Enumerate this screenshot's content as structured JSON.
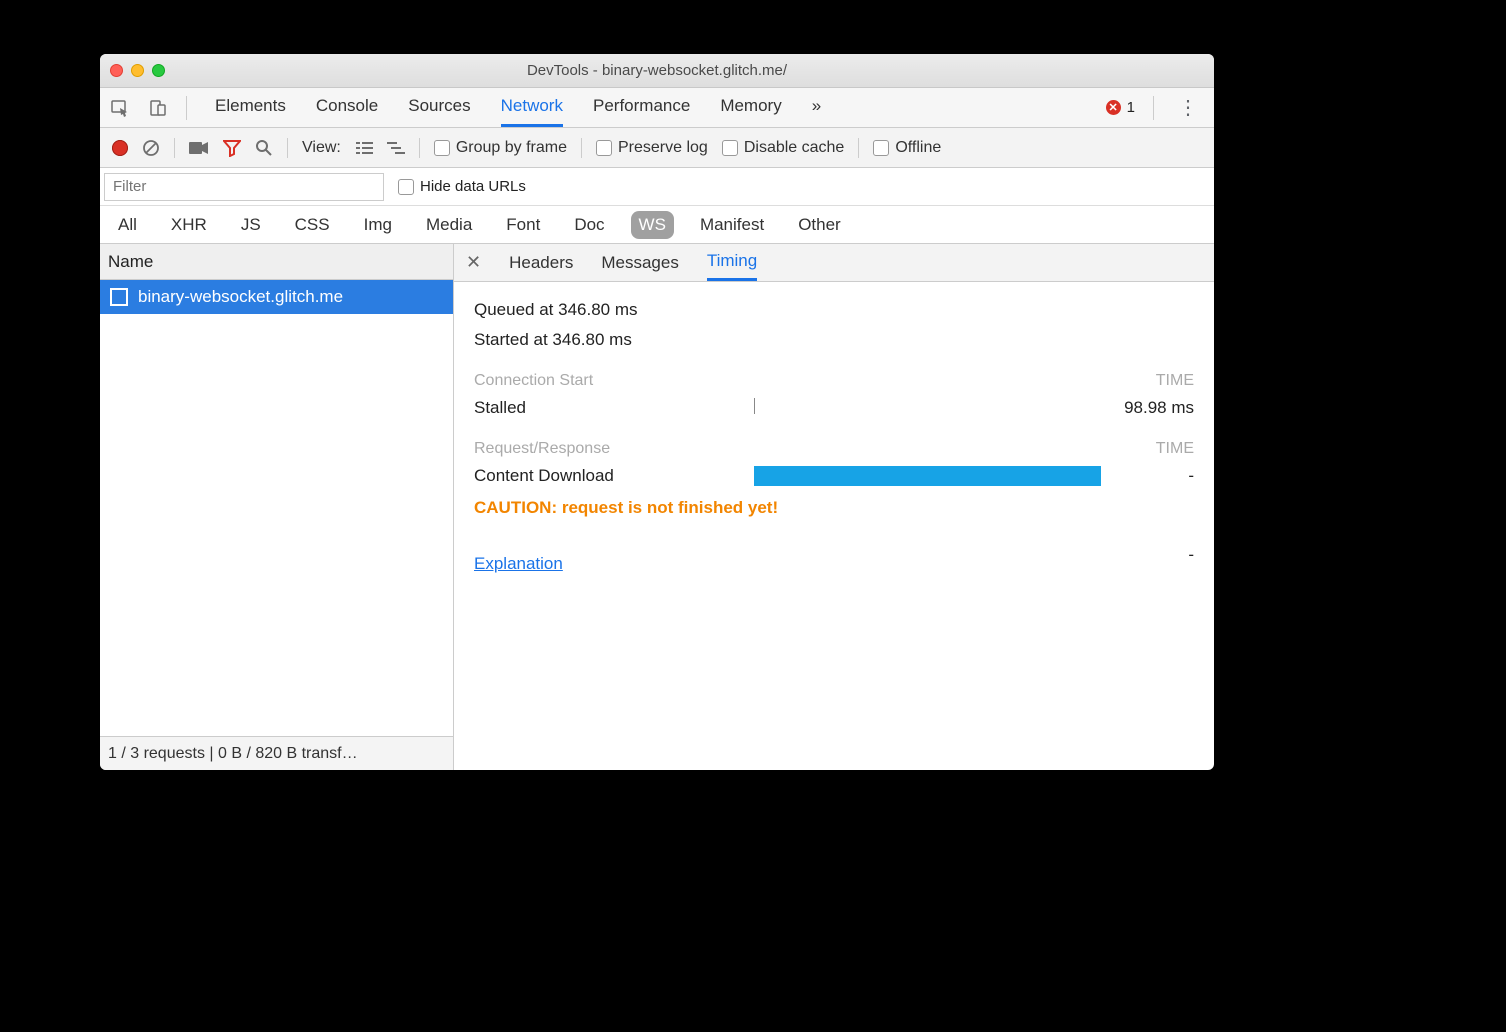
{
  "window": {
    "title": "DevTools - binary-websocket.glitch.me/"
  },
  "mainTabs": {
    "items": [
      "Elements",
      "Console",
      "Sources",
      "Network",
      "Performance",
      "Memory"
    ],
    "active": "Network",
    "overflow": "»",
    "errorCount": "1"
  },
  "toolbar": {
    "viewLabel": "View:",
    "groupByFrame": "Group by frame",
    "preserveLog": "Preserve log",
    "disableCache": "Disable cache",
    "offline": "Offline"
  },
  "filter": {
    "placeholder": "Filter",
    "hideDataUrls": "Hide data URLs"
  },
  "typeFilters": {
    "items": [
      "All",
      "XHR",
      "JS",
      "CSS",
      "Img",
      "Media",
      "Font",
      "Doc",
      "WS",
      "Manifest",
      "Other"
    ],
    "active": "WS"
  },
  "nameColumn": {
    "header": "Name"
  },
  "requests": [
    {
      "name": "binary-websocket.glitch.me",
      "selected": true
    }
  ],
  "status": "1 / 3 requests | 0 B / 820 B transf…",
  "detailTabs": {
    "items": [
      "Headers",
      "Messages",
      "Timing"
    ],
    "active": "Timing"
  },
  "timing": {
    "queued": "Queued at 346.80 ms",
    "started": "Started at 346.80 ms",
    "connStartHeader": "Connection Start",
    "timeHeader": "TIME",
    "stalledLabel": "Stalled",
    "stalledValue": "98.98 ms",
    "reqRespHeader": "Request/Response",
    "contentDownloadLabel": "Content Download",
    "contentDownloadValue": "-",
    "caution": "CAUTION: request is not finished yet!",
    "explanation": "Explanation",
    "totalValue": "-"
  }
}
